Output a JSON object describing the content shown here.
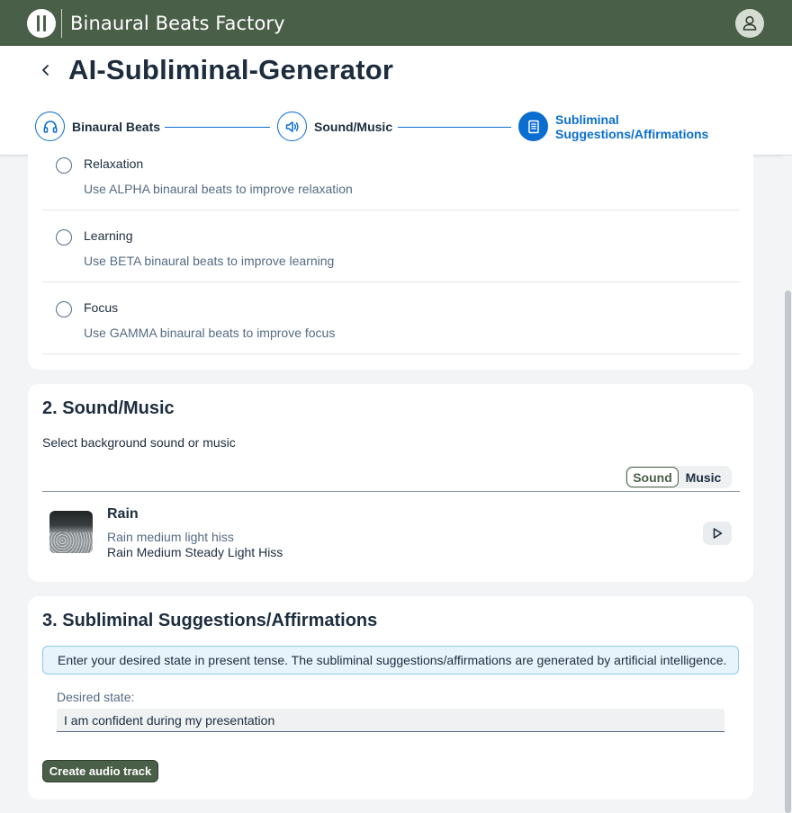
{
  "shell": {
    "app_title": "Binaural Beats Factory",
    "logo_icon": "binaural-logo-icon",
    "avatar_icon": "user-icon"
  },
  "header": {
    "title": "AI-Subliminal-Generator",
    "back_icon": "chevron-left-icon",
    "steps": [
      {
        "label": "Binaural Beats",
        "icon": "headphones-icon",
        "active": false
      },
      {
        "label": "Sound/Music",
        "icon": "speaker-icon",
        "active": false
      },
      {
        "label_line1": "Subliminal",
        "label_line2": "Suggestions/Affirmations",
        "icon": "document-icon",
        "active": true
      }
    ]
  },
  "binaural": {
    "options": [
      {
        "title": "Relaxation",
        "desc": "Use ALPHA binaural beats to improve relaxation"
      },
      {
        "title": "Learning",
        "desc": "Use BETA binaural beats to improve learning"
      },
      {
        "title": "Focus",
        "desc": "Use GAMMA binaural beats to improve focus"
      }
    ]
  },
  "sound": {
    "title": "2. Sound/Music",
    "desc": "Select background sound or music",
    "segments": [
      {
        "label": "Sound",
        "selected": true
      },
      {
        "label": "Music",
        "selected": false
      }
    ],
    "item": {
      "title": "Rain",
      "subtitle": "Rain medium light hiss",
      "description": "Rain Medium Steady Light Hiss",
      "play_icon": "play-icon"
    }
  },
  "affirmations": {
    "title": "3. Subliminal Suggestions/Affirmations",
    "info": "Enter your desired state in present tense. The subliminal suggestions/affirmations are generated by artificial intelligence.",
    "field_label": "Desired state:",
    "field_value": "I am confident during my presentation",
    "button_label": "Create audio track"
  },
  "colors": {
    "shell": "#4a5f47",
    "accent": "#0a6ed1",
    "text": "#1d2d3e",
    "muted": "#556b82",
    "info_bg": "#e8f4fc"
  }
}
